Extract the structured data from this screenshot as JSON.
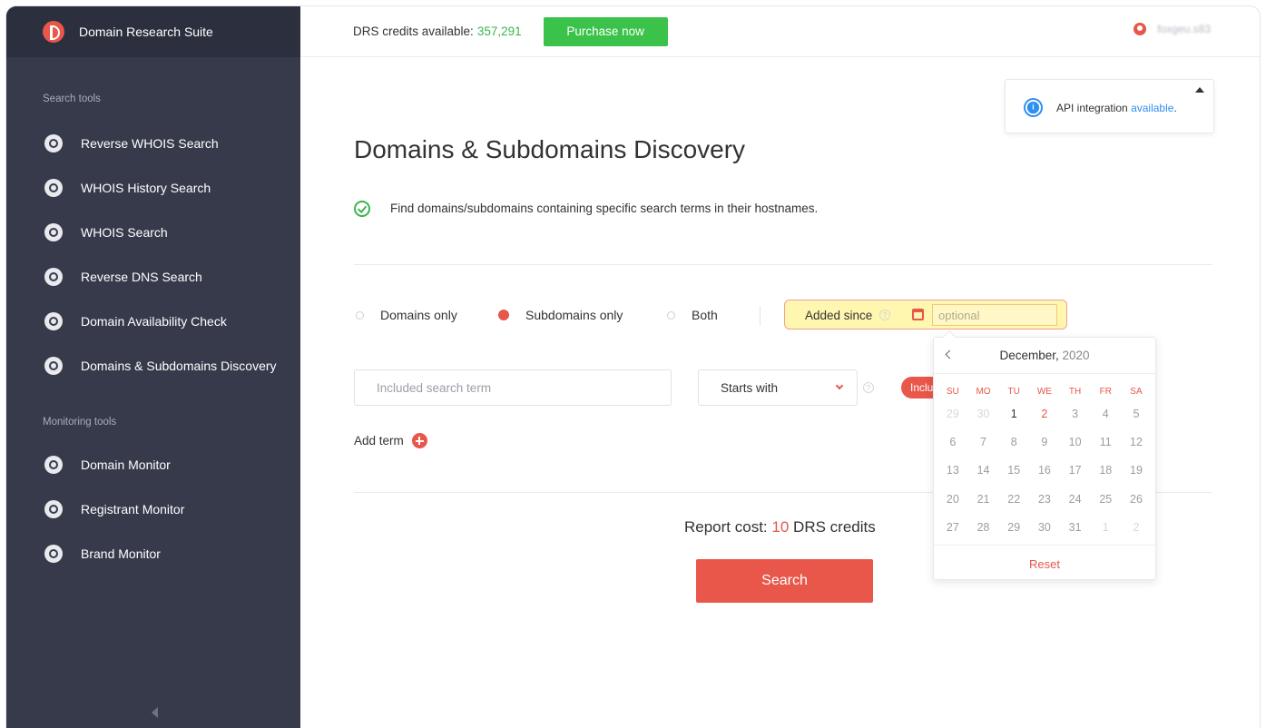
{
  "sidebar": {
    "brand": "Domain Research Suite",
    "search_tools_title": "Search tools",
    "search_tools": [
      {
        "label": "Reverse WHOIS Search",
        "icon": "reverse-whois-icon"
      },
      {
        "label": "WHOIS History Search",
        "icon": "history-icon"
      },
      {
        "label": "WHOIS Search",
        "icon": "user-search-icon"
      },
      {
        "label": "Reverse DNS Search",
        "icon": "globe-icon"
      },
      {
        "label": "Domain Availability Check",
        "icon": "exclamation-icon"
      },
      {
        "label": "Domains & Subdomains Discovery",
        "icon": "discovery-icon"
      }
    ],
    "monitoring_tools_title": "Monitoring tools",
    "monitoring_tools": [
      {
        "label": "Domain Monitor",
        "icon": "domain-monitor-icon"
      },
      {
        "label": "Registrant Monitor",
        "icon": "registrant-icon"
      },
      {
        "label": "Brand Monitor",
        "icon": "registered-icon"
      }
    ]
  },
  "topbar": {
    "credits_label": "DRS credits available:",
    "credits_value": "357,291",
    "purchase_label": "Purchase now",
    "username": "foxgeu.s83"
  },
  "api_box": {
    "text": "API integration",
    "link": "available",
    "suffix": "."
  },
  "main": {
    "title": "Domains & Subdomains Discovery",
    "description": "Find domains/subdomains containing specific search terms in their hostnames.",
    "radios": [
      {
        "label": "Domains only",
        "selected": false
      },
      {
        "label": "Subdomains only",
        "selected": true
      },
      {
        "label": "Both",
        "selected": false
      }
    ],
    "added_since_label": "Added since",
    "date_placeholder": "optional",
    "term_placeholder": "Included search term",
    "match_mode": "Starts with",
    "include_pill": "Inclu",
    "add_term_label": "Add term",
    "report_cost_label": "Report cost:",
    "report_cost_value": "10",
    "report_cost_unit": "DRS credits",
    "search_label": "Search"
  },
  "calendar": {
    "month": "December,",
    "year": "2020",
    "weekdays": [
      "SU",
      "MO",
      "TU",
      "WE",
      "TH",
      "FR",
      "SA"
    ],
    "weeks": [
      [
        "29",
        "30",
        "1",
        "2",
        "3",
        "4",
        "5"
      ],
      [
        "6",
        "7",
        "8",
        "9",
        "10",
        "11",
        "12"
      ],
      [
        "13",
        "14",
        "15",
        "16",
        "17",
        "18",
        "19"
      ],
      [
        "20",
        "21",
        "22",
        "23",
        "24",
        "25",
        "26"
      ],
      [
        "27",
        "28",
        "29",
        "30",
        "31",
        "1",
        "2"
      ]
    ],
    "reset_label": "Reset"
  },
  "colors": {
    "accent": "#e8574a",
    "success": "#3ac24a",
    "sidebar": "#363a4b",
    "link": "#2f8ff0"
  }
}
